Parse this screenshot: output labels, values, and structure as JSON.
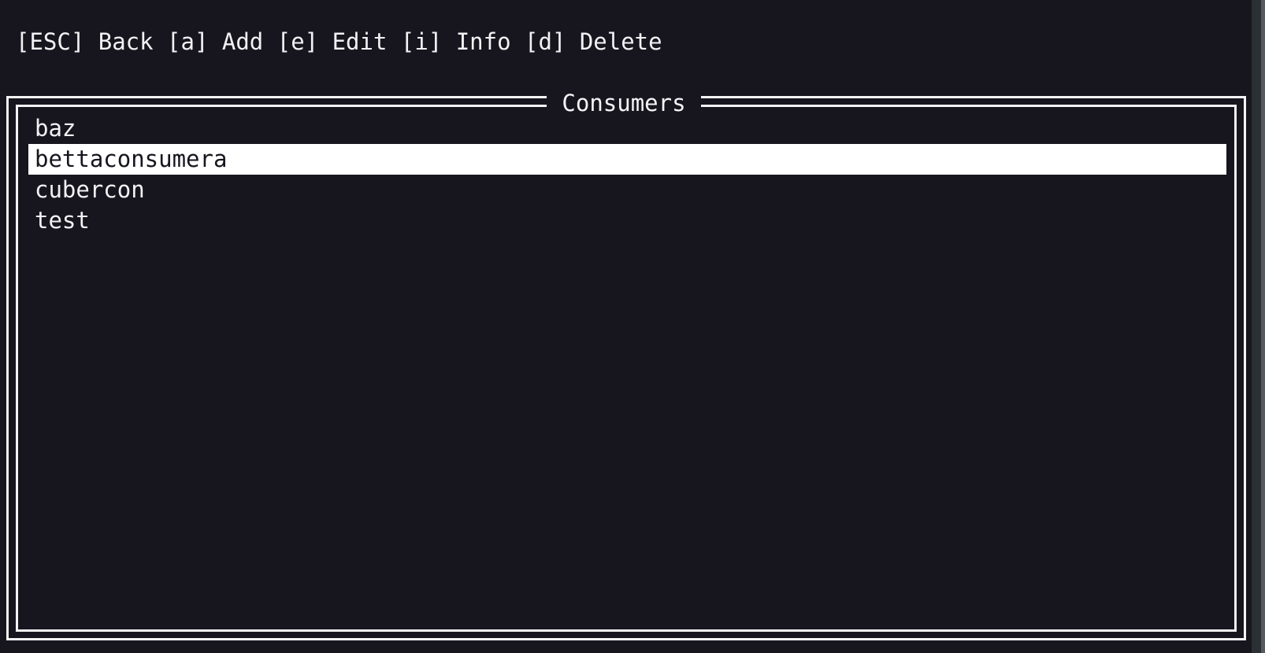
{
  "theme": {
    "background": "#17161f",
    "foreground": "#f2f2f4",
    "border": "#f4f4f6",
    "selection_background": "#ffffff",
    "selection_foreground": "#17161f",
    "scrollbar_track": "#2b3034",
    "scrollbar_edge": "#555b5e"
  },
  "keybar": {
    "text": "[ESC] Back [a] Add [e] Edit [i] Info [d] Delete",
    "actions": [
      {
        "key": "[ESC]",
        "label": "Back"
      },
      {
        "key": "[a]",
        "label": "Add"
      },
      {
        "key": "[e]",
        "label": "Edit"
      },
      {
        "key": "[i]",
        "label": "Info"
      },
      {
        "key": "[d]",
        "label": "Delete"
      }
    ]
  },
  "panel": {
    "title": "Consumers",
    "items": [
      {
        "name": "baz",
        "selected": false
      },
      {
        "name": "bettaconsumera",
        "selected": true
      },
      {
        "name": "cubercon",
        "selected": false
      },
      {
        "name": "test",
        "selected": false
      }
    ]
  }
}
